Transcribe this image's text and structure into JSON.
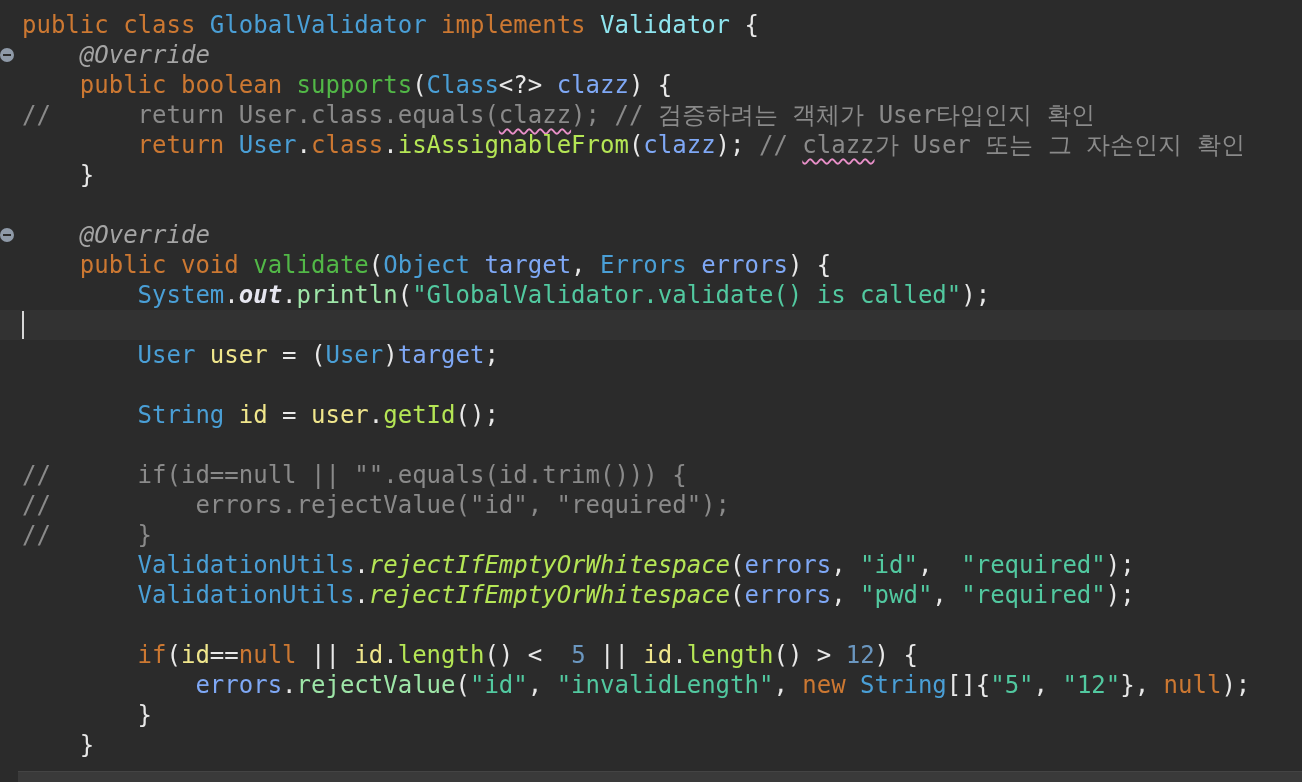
{
  "editor": {
    "lines": [
      {
        "kind": "code",
        "tokens": [
          {
            "text": "public",
            "kind": "keyword"
          },
          {
            "text": " class",
            "kind": "keyword"
          },
          {
            "text": " GlobalValidator",
            "kind": "type"
          },
          {
            "text": " implements",
            "kind": "keyword"
          },
          {
            "text": " Validator",
            "kind": "interface"
          },
          {
            "text": " {",
            "kind": "plain"
          }
        ]
      },
      {
        "kind": "code",
        "fold": true,
        "tokens": [
          {
            "text": "    @Override",
            "kind": "annotation"
          }
        ]
      },
      {
        "kind": "code",
        "tokens": [
          {
            "text": "    public",
            "kind": "keyword"
          },
          {
            "text": " boolean",
            "kind": "keyword"
          },
          {
            "text": " supports",
            "kind": "declaration"
          },
          {
            "text": "(",
            "kind": "plain"
          },
          {
            "text": "Class",
            "kind": "type"
          },
          {
            "text": "<?>",
            "kind": "plain"
          },
          {
            "text": " clazz",
            "kind": "parameter"
          },
          {
            "text": ") {",
            "kind": "plain"
          }
        ]
      },
      {
        "kind": "code",
        "tokens": [
          {
            "text": "//      return User.class.equals(",
            "kind": "comment"
          },
          {
            "text": "clazz",
            "kind": "comment",
            "misspelled": true
          },
          {
            "text": "); // 검증하려는 객체가 User타입인지 확인",
            "kind": "comment"
          }
        ]
      },
      {
        "kind": "code",
        "tokens": [
          {
            "text": "        return",
            "kind": "keyword"
          },
          {
            "text": " User",
            "kind": "type"
          },
          {
            "text": ".",
            "kind": "plain"
          },
          {
            "text": "class",
            "kind": "keyword"
          },
          {
            "text": ".",
            "kind": "plain"
          },
          {
            "text": "isAssignableFrom",
            "kind": "call"
          },
          {
            "text": "(",
            "kind": "plain"
          },
          {
            "text": "clazz",
            "kind": "parameter"
          },
          {
            "text": ");",
            "kind": "plain"
          },
          {
            "text": " // ",
            "kind": "comment"
          },
          {
            "text": "clazz",
            "kind": "comment",
            "misspelled": true
          },
          {
            "text": "가 User 또는 그 자손인지 확인",
            "kind": "comment"
          }
        ]
      },
      {
        "kind": "code",
        "tokens": [
          {
            "text": "    }",
            "kind": "plain"
          }
        ]
      },
      {
        "kind": "blank"
      },
      {
        "kind": "code",
        "fold": true,
        "tokens": [
          {
            "text": "    @Override",
            "kind": "annotation"
          }
        ]
      },
      {
        "kind": "code",
        "tokens": [
          {
            "text": "    public",
            "kind": "keyword"
          },
          {
            "text": " void",
            "kind": "keyword"
          },
          {
            "text": " validate",
            "kind": "declaration"
          },
          {
            "text": "(",
            "kind": "plain"
          },
          {
            "text": "Object",
            "kind": "type"
          },
          {
            "text": " target",
            "kind": "parameter"
          },
          {
            "text": ", ",
            "kind": "plain"
          },
          {
            "text": "Errors",
            "kind": "type"
          },
          {
            "text": " errors",
            "kind": "parameter"
          },
          {
            "text": ") {",
            "kind": "plain"
          }
        ]
      },
      {
        "kind": "code",
        "tokens": [
          {
            "text": "        System",
            "kind": "type"
          },
          {
            "text": ".",
            "kind": "plain"
          },
          {
            "text": "out",
            "kind": "static_field"
          },
          {
            "text": ".",
            "kind": "plain"
          },
          {
            "text": "println",
            "kind": "call_other"
          },
          {
            "text": "(",
            "kind": "plain"
          },
          {
            "text": "\"GlobalValidator.validate() is called\"",
            "kind": "string"
          },
          {
            "text": ");",
            "kind": "plain"
          }
        ]
      },
      {
        "kind": "blank",
        "current": true,
        "cursor": true
      },
      {
        "kind": "code",
        "tokens": [
          {
            "text": "        User",
            "kind": "type"
          },
          {
            "text": " user",
            "kind": "local"
          },
          {
            "text": " = (",
            "kind": "plain"
          },
          {
            "text": "User",
            "kind": "type"
          },
          {
            "text": ")",
            "kind": "plain"
          },
          {
            "text": "target",
            "kind": "parameter"
          },
          {
            "text": ";",
            "kind": "plain"
          }
        ]
      },
      {
        "kind": "blank"
      },
      {
        "kind": "code",
        "tokens": [
          {
            "text": "        String",
            "kind": "type"
          },
          {
            "text": " id",
            "kind": "local"
          },
          {
            "text": " = ",
            "kind": "plain"
          },
          {
            "text": "user",
            "kind": "local"
          },
          {
            "text": ".",
            "kind": "plain"
          },
          {
            "text": "getId",
            "kind": "call"
          },
          {
            "text": "();",
            "kind": "plain"
          }
        ]
      },
      {
        "kind": "blank"
      },
      {
        "kind": "code",
        "tokens": [
          {
            "text": "//      if(id==null || \"\".equals(id.trim())) {",
            "kind": "comment"
          }
        ]
      },
      {
        "kind": "code",
        "tokens": [
          {
            "text": "//          errors.rejectValue(\"id\", \"required\");",
            "kind": "comment"
          }
        ]
      },
      {
        "kind": "code",
        "tokens": [
          {
            "text": "//      }",
            "kind": "comment"
          }
        ]
      },
      {
        "kind": "code",
        "tokens": [
          {
            "text": "        ValidationUtils",
            "kind": "type"
          },
          {
            "text": ".",
            "kind": "plain"
          },
          {
            "text": "rejectIfEmptyOrWhitespace",
            "kind": "static_call"
          },
          {
            "text": "(",
            "kind": "plain"
          },
          {
            "text": "errors",
            "kind": "parameter"
          },
          {
            "text": ", ",
            "kind": "plain"
          },
          {
            "text": "\"id\"",
            "kind": "string"
          },
          {
            "text": ",  ",
            "kind": "plain"
          },
          {
            "text": "\"required\"",
            "kind": "string"
          },
          {
            "text": ");",
            "kind": "plain"
          }
        ]
      },
      {
        "kind": "code",
        "tokens": [
          {
            "text": "        ValidationUtils",
            "kind": "type"
          },
          {
            "text": ".",
            "kind": "plain"
          },
          {
            "text": "rejectIfEmptyOrWhitespace",
            "kind": "static_call"
          },
          {
            "text": "(",
            "kind": "plain"
          },
          {
            "text": "errors",
            "kind": "parameter"
          },
          {
            "text": ", ",
            "kind": "plain"
          },
          {
            "text": "\"pwd\"",
            "kind": "string"
          },
          {
            "text": ", ",
            "kind": "plain"
          },
          {
            "text": "\"required\"",
            "kind": "string"
          },
          {
            "text": ");",
            "kind": "plain"
          }
        ]
      },
      {
        "kind": "blank"
      },
      {
        "kind": "code",
        "tokens": [
          {
            "text": "        if",
            "kind": "keyword"
          },
          {
            "text": "(",
            "kind": "plain"
          },
          {
            "text": "id",
            "kind": "local"
          },
          {
            "text": "==",
            "kind": "plain"
          },
          {
            "text": "null",
            "kind": "keyword"
          },
          {
            "text": " || ",
            "kind": "plain"
          },
          {
            "text": "id",
            "kind": "local"
          },
          {
            "text": ".",
            "kind": "plain"
          },
          {
            "text": "length",
            "kind": "call"
          },
          {
            "text": "() <  ",
            "kind": "plain"
          },
          {
            "text": "5",
            "kind": "number"
          },
          {
            "text": " || ",
            "kind": "plain"
          },
          {
            "text": "id",
            "kind": "local"
          },
          {
            "text": ".",
            "kind": "plain"
          },
          {
            "text": "length",
            "kind": "call"
          },
          {
            "text": "() > ",
            "kind": "plain"
          },
          {
            "text": "12",
            "kind": "number"
          },
          {
            "text": ") {",
            "kind": "plain"
          }
        ]
      },
      {
        "kind": "code",
        "tokens": [
          {
            "text": "            errors",
            "kind": "parameter"
          },
          {
            "text": ".",
            "kind": "plain"
          },
          {
            "text": "rejectValue",
            "kind": "call_other"
          },
          {
            "text": "(",
            "kind": "plain"
          },
          {
            "text": "\"id\"",
            "kind": "string"
          },
          {
            "text": ", ",
            "kind": "plain"
          },
          {
            "text": "\"invalidLength\"",
            "kind": "string"
          },
          {
            "text": ", ",
            "kind": "plain"
          },
          {
            "text": "new",
            "kind": "keyword"
          },
          {
            "text": " String",
            "kind": "type"
          },
          {
            "text": "[]{",
            "kind": "plain"
          },
          {
            "text": "\"5\"",
            "kind": "string"
          },
          {
            "text": ", ",
            "kind": "plain"
          },
          {
            "text": "\"12\"",
            "kind": "string"
          },
          {
            "text": "}, ",
            "kind": "plain"
          },
          {
            "text": "null",
            "kind": "keyword"
          },
          {
            "text": ");",
            "kind": "plain"
          }
        ]
      },
      {
        "kind": "code",
        "tokens": [
          {
            "text": "        }",
            "kind": "plain"
          }
        ]
      },
      {
        "kind": "code",
        "tokens": [
          {
            "text": "    }",
            "kind": "plain"
          }
        ]
      }
    ]
  }
}
